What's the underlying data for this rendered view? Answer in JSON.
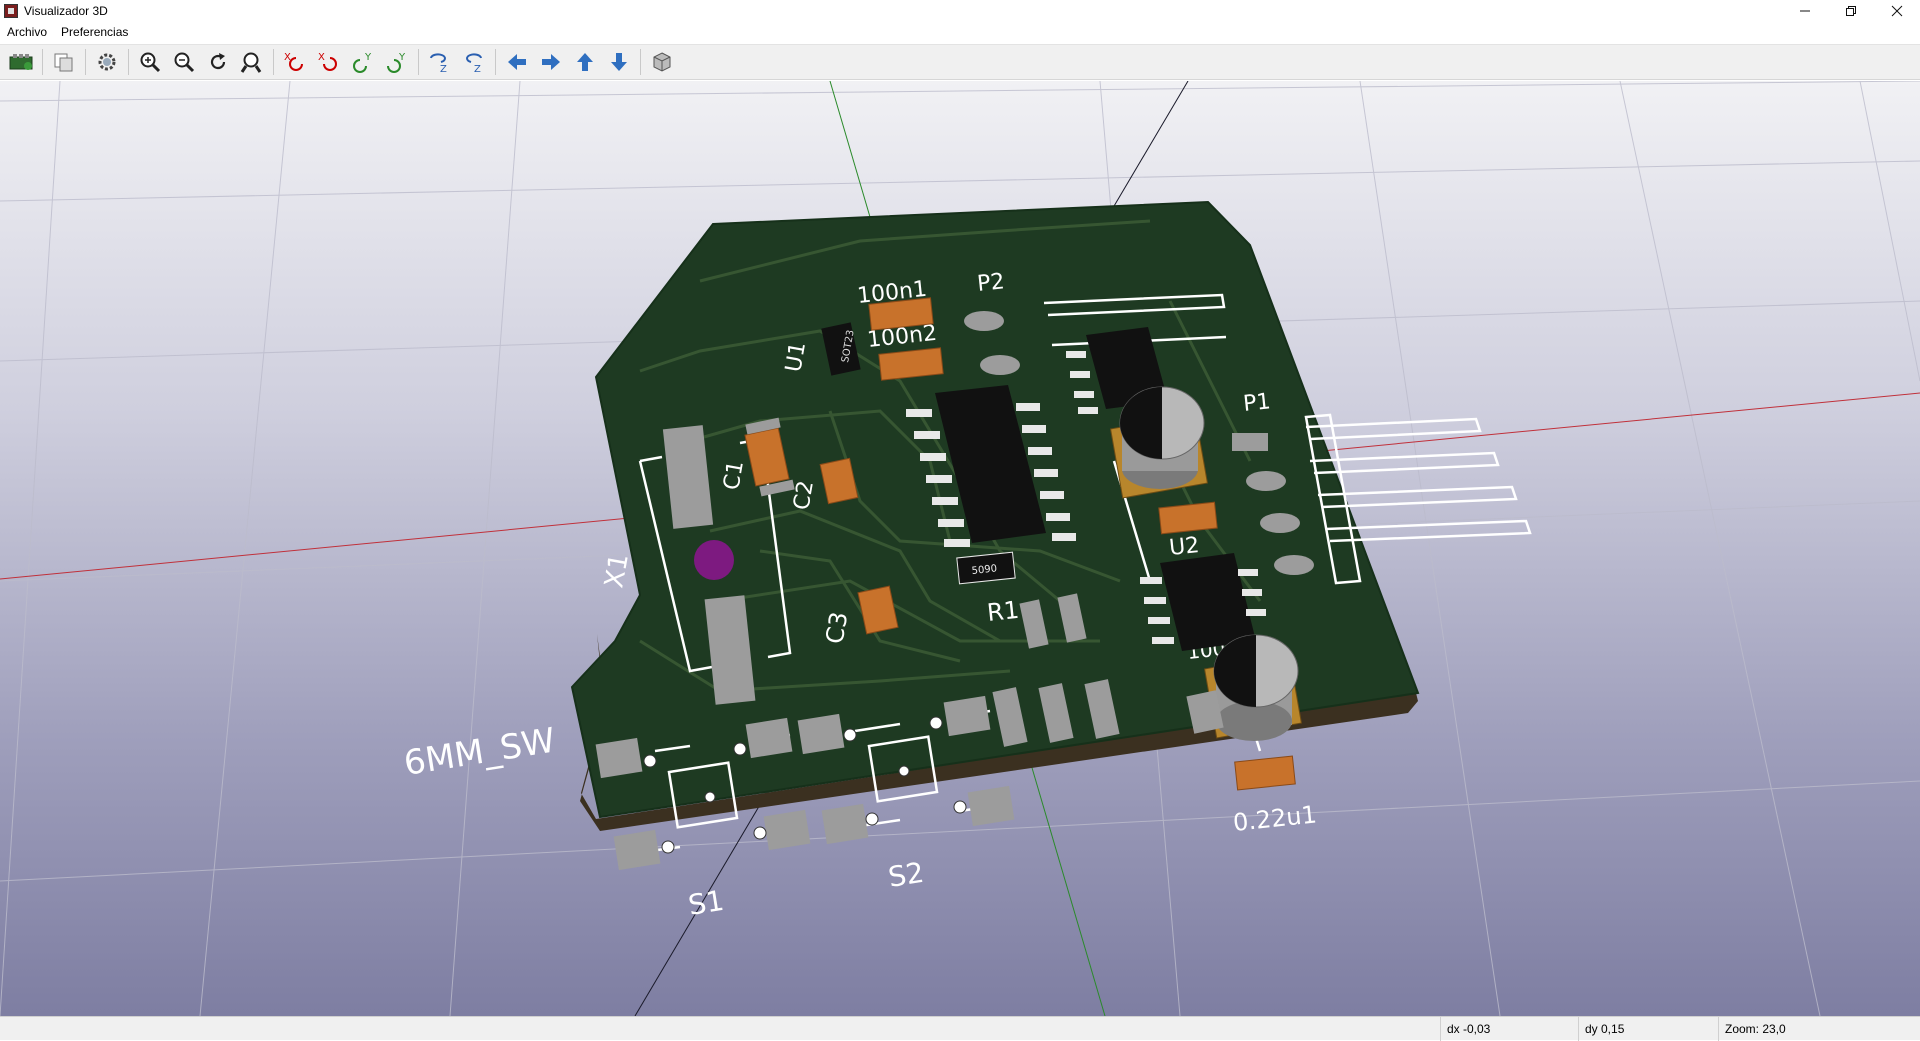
{
  "window": {
    "title": "Visualizador 3D"
  },
  "menu": {
    "items": [
      "Archivo",
      "Preferencias"
    ]
  },
  "toolbar": {
    "buttons": [
      "reload-board-icon",
      "copy-image-icon",
      "settings-icon",
      "zoom-in-icon",
      "zoom-out-icon",
      "refresh-icon",
      "zoom-fit-icon",
      "rotate-x-cw-icon",
      "rotate-x-ccw-icon",
      "rotate-y-cw-icon",
      "rotate-y-ccw-icon",
      "rotate-z-cw-icon",
      "rotate-z-ccw-icon",
      "move-left-icon",
      "move-right-icon",
      "move-up-icon",
      "move-down-icon",
      "ortho-view-icon"
    ]
  },
  "board": {
    "labels": {
      "c_100n1": "100n1",
      "p2": "P2",
      "c_100n2": "100n2",
      "u1": "U1",
      "sot23": "SOT23",
      "p1": "P1",
      "c1": "C1",
      "c2": "C2",
      "x1": "X1",
      "c3": "C3",
      "r1": "R1",
      "r_marking": "5090",
      "u2": "U2",
      "c_100": "100",
      "c_022u1": "0.22u1",
      "sw_footprint": "6MM_SW",
      "s1": "S1",
      "s2": "S2"
    },
    "colors": {
      "soldermask": "#1e3a22",
      "pad": "#9c9c9c",
      "silk": "#ffffff",
      "cap": "#c8722b",
      "ic": "#111111"
    }
  },
  "status": {
    "dx": "dx -0,03",
    "dy": "dy 0,15",
    "zoom": "Zoom: 23,0"
  }
}
